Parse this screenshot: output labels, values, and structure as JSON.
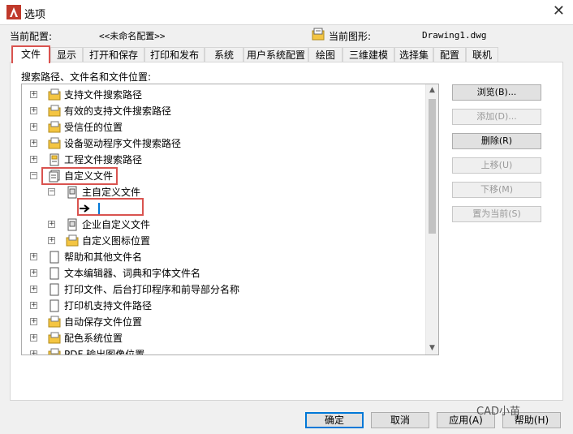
{
  "window": {
    "title": "选项"
  },
  "header": {
    "profile_label": "当前配置:",
    "profile_value": "<<未命名配置>>",
    "drawing_label": "当前图形:",
    "drawing_value": "Drawing1.dwg"
  },
  "tabs": [
    {
      "label": "文件"
    },
    {
      "label": "显示"
    },
    {
      "label": "打开和保存"
    },
    {
      "label": "打印和发布"
    },
    {
      "label": "系统"
    },
    {
      "label": "用户系统配置"
    },
    {
      "label": "绘图"
    },
    {
      "label": "三维建模"
    },
    {
      "label": "选择集"
    },
    {
      "label": "配置"
    },
    {
      "label": "联机"
    }
  ],
  "panel": {
    "label": "搜索路径、文件名和文件位置:"
  },
  "tree": [
    {
      "label": "支持文件搜索路径"
    },
    {
      "label": "有效的支持文件搜索路径"
    },
    {
      "label": "受信任的位置"
    },
    {
      "label": "设备驱动程序文件搜索路径"
    },
    {
      "label": "工程文件搜索路径"
    },
    {
      "label": "自定义文件"
    },
    {
      "label": "主自定义文件"
    },
    {
      "label": ""
    },
    {
      "label": "企业自定义文件"
    },
    {
      "label": "自定义图标位置"
    },
    {
      "label": "帮助和其他文件名"
    },
    {
      "label": "文本编辑器、词典和字体文件名"
    },
    {
      "label": "打印文件、后台打印程序和前导部分名称"
    },
    {
      "label": "打印机支持文件路径"
    },
    {
      "label": "自动保存文件位置"
    },
    {
      "label": "配色系统位置"
    },
    {
      "label": "PDF 输出图像位置"
    }
  ],
  "side_buttons": {
    "browse": "浏览(B)...",
    "add": "添加(D)...",
    "delete": "删除(R)",
    "move_up": "上移(U)",
    "move_down": "下移(M)",
    "set_current": "置为当前(S)"
  },
  "bottom_buttons": {
    "ok": "确定",
    "cancel": "取消",
    "apply": "应用(A)",
    "help": "帮助(H)"
  },
  "watermark": "CAD小苗",
  "colors": {
    "highlight": "#d9534f",
    "default_button": "#0078d7",
    "folder": "#f4c542"
  }
}
